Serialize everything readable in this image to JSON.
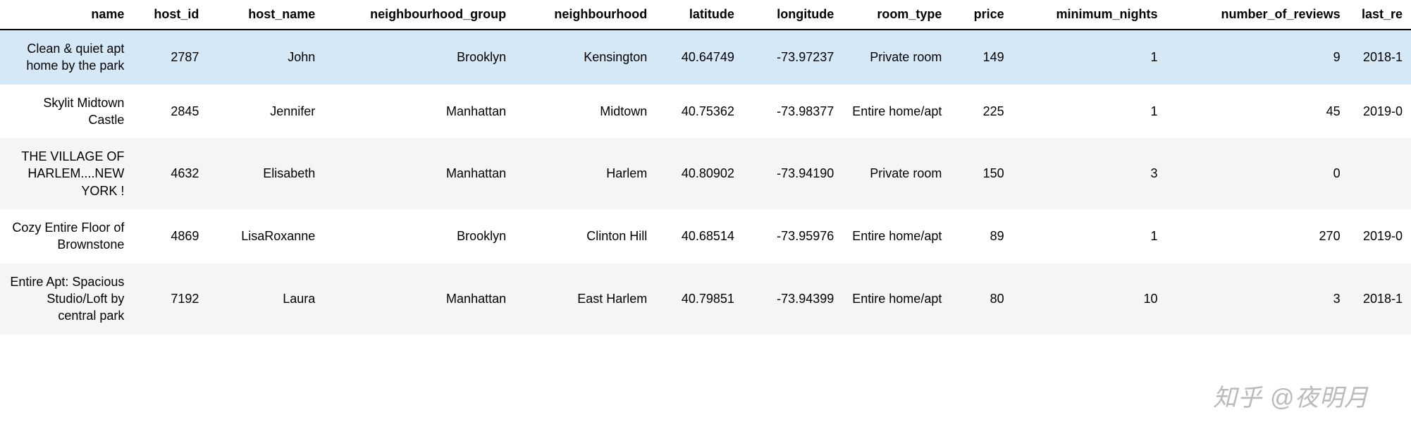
{
  "columns": [
    {
      "key": "name",
      "label": "name",
      "cls": "col-name"
    },
    {
      "key": "host_id",
      "label": "host_id",
      "cls": "col-hostid"
    },
    {
      "key": "host_name",
      "label": "host_name",
      "cls": "col-hostname"
    },
    {
      "key": "neighbourhood_group",
      "label": "neighbourhood_group",
      "cls": "col-ngroup"
    },
    {
      "key": "neighbourhood",
      "label": "neighbourhood",
      "cls": "col-nhood"
    },
    {
      "key": "latitude",
      "label": "latitude",
      "cls": "col-lat"
    },
    {
      "key": "longitude",
      "label": "longitude",
      "cls": "col-lon"
    },
    {
      "key": "room_type",
      "label": "room_type",
      "cls": "col-roomtype"
    },
    {
      "key": "price",
      "label": "price",
      "cls": "col-price"
    },
    {
      "key": "minimum_nights",
      "label": "minimum_nights",
      "cls": "col-minnights"
    },
    {
      "key": "number_of_reviews",
      "label": "number_of_reviews",
      "cls": "col-nreviews"
    },
    {
      "key": "last_review",
      "label": "last_re",
      "cls": "col-lastrev"
    }
  ],
  "rows": [
    {
      "selected": true,
      "name": "Clean & quiet apt home by the park",
      "host_id": "2787",
      "host_name": "John",
      "neighbourhood_group": "Brooklyn",
      "neighbourhood": "Kensington",
      "latitude": "40.64749",
      "longitude": "-73.97237",
      "room_type": "Private room",
      "price": "149",
      "minimum_nights": "1",
      "number_of_reviews": "9",
      "last_review": "2018-1"
    },
    {
      "name": "Skylit Midtown Castle",
      "host_id": "2845",
      "host_name": "Jennifer",
      "neighbourhood_group": "Manhattan",
      "neighbourhood": "Midtown",
      "latitude": "40.75362",
      "longitude": "-73.98377",
      "room_type": "Entire home/apt",
      "price": "225",
      "minimum_nights": "1",
      "number_of_reviews": "45",
      "last_review": "2019-0"
    },
    {
      "name": "THE VILLAGE OF HARLEM....NEW YORK !",
      "host_id": "4632",
      "host_name": "Elisabeth",
      "neighbourhood_group": "Manhattan",
      "neighbourhood": "Harlem",
      "latitude": "40.80902",
      "longitude": "-73.94190",
      "room_type": "Private room",
      "price": "150",
      "minimum_nights": "3",
      "number_of_reviews": "0",
      "last_review": ""
    },
    {
      "name": "Cozy Entire Floor of Brownstone",
      "host_id": "4869",
      "host_name": "LisaRoxanne",
      "neighbourhood_group": "Brooklyn",
      "neighbourhood": "Clinton Hill",
      "latitude": "40.68514",
      "longitude": "-73.95976",
      "room_type": "Entire home/apt",
      "price": "89",
      "minimum_nights": "1",
      "number_of_reviews": "270",
      "last_review": "2019-0"
    },
    {
      "name": "Entire Apt: Spacious Studio/Loft by central park",
      "host_id": "7192",
      "host_name": "Laura",
      "neighbourhood_group": "Manhattan",
      "neighbourhood": "East Harlem",
      "latitude": "40.79851",
      "longitude": "-73.94399",
      "room_type": "Entire home/apt",
      "price": "80",
      "minimum_nights": "10",
      "number_of_reviews": "3",
      "last_review": "2018-1"
    }
  ],
  "watermark": "知乎 @夜明月"
}
